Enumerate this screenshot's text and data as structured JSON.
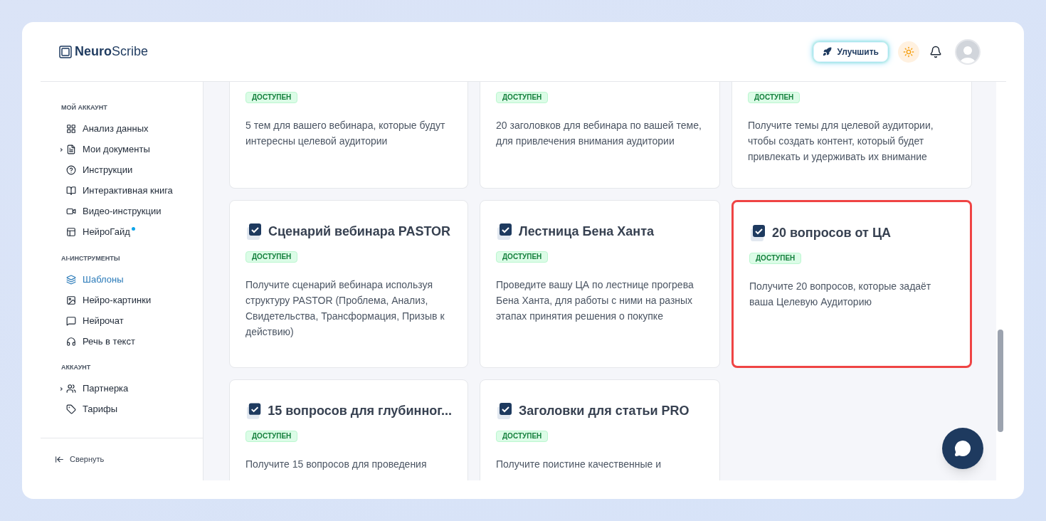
{
  "logo": {
    "bold": "Neuro",
    "light": "Scribe"
  },
  "header": {
    "upgrade_button": "Улучшить"
  },
  "sidebar": {
    "sections": [
      {
        "title": "МОЙ АККАУНТ",
        "items": [
          {
            "label": "Анализ данных",
            "expandable": false,
            "selected": false,
            "dot": false
          },
          {
            "label": "Мои документы",
            "expandable": true,
            "selected": false,
            "dot": false
          },
          {
            "label": "Инструкции",
            "expandable": false,
            "selected": false,
            "dot": false
          },
          {
            "label": "Интерактивная книга",
            "expandable": false,
            "selected": false,
            "dot": false
          },
          {
            "label": "Видео-инструкции",
            "expandable": false,
            "selected": false,
            "dot": false
          },
          {
            "label": "НейроГайд",
            "expandable": false,
            "selected": false,
            "dot": true
          }
        ]
      },
      {
        "title": "AI-ИНСТРУМЕНТЫ",
        "items": [
          {
            "label": "Шаблоны",
            "expandable": false,
            "selected": true,
            "dot": false
          },
          {
            "label": "Нейро-картинки",
            "expandable": false,
            "selected": false,
            "dot": false
          },
          {
            "label": "Нейрочат",
            "expandable": false,
            "selected": false,
            "dot": false
          },
          {
            "label": "Речь в текст",
            "expandable": false,
            "selected": false,
            "dot": false
          }
        ]
      },
      {
        "title": "АККАУНТ",
        "items": [
          {
            "label": "Партнерка",
            "expandable": true,
            "selected": false,
            "dot": false
          },
          {
            "label": "Тарифы",
            "expandable": false,
            "selected": false,
            "dot": false
          }
        ]
      }
    ],
    "collapse": "Свернуть"
  },
  "cards": [
    {
      "badge": "ДОСТУПЕН",
      "description": "5 тем для вашего вебинара, которые будут интересны целевой аудитории",
      "highlighted": false
    },
    {
      "badge": "ДОСТУПЕН",
      "description": "20 заголовков для вебинара по вашей теме, для привлечения внимания аудитории",
      "highlighted": false
    },
    {
      "badge": "ДОСТУПЕН",
      "description": "Получите темы для целевой аудитории, чтобы создать контент, который будет привлекать и удерживать их внимание",
      "highlighted": false
    },
    {
      "title": "Сценарий вебинара PASTOR",
      "badge": "ДОСТУПЕН",
      "description": "Получите сценарий вебинара используя структуру PASTOR (Проблема, Анализ, Свидетельства, Трансформация, Призыв к действию)",
      "highlighted": false
    },
    {
      "title": "Лестница Бена Ханта",
      "badge": "ДОСТУПЕН",
      "description": "Проведите вашу ЦА по лестнице прогрева Бена Ханта, для работы с ними на разных этапах принятия решения о покупке",
      "highlighted": false
    },
    {
      "title": "20 вопросов от ЦА",
      "badge": "ДОСТУПЕН",
      "description": "Получите 20 вопросов, которые задаёт ваша Целевую Аудиторию",
      "highlighted": true
    },
    {
      "title": "15 вопросов для глубинног...",
      "badge": "ДОСТУПЕН",
      "description": "Получите 15 вопросов для проведения",
      "highlighted": false
    },
    {
      "title": "Заголовки для статьи PRO",
      "badge": "ДОСТУПЕН",
      "description": "Получите поистине качественные и",
      "highlighted": false
    }
  ]
}
